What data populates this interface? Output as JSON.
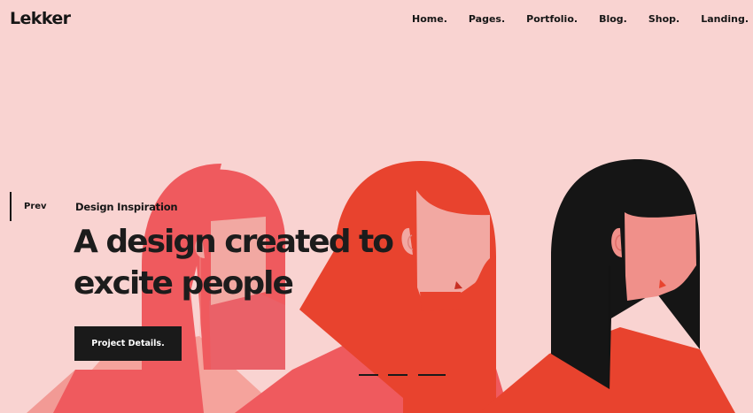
{
  "brand": {
    "logo": "Lekker"
  },
  "nav": {
    "items": [
      {
        "label": "Home."
      },
      {
        "label": "Pages."
      },
      {
        "label": "Portfolio."
      },
      {
        "label": "Blog."
      },
      {
        "label": "Shop."
      },
      {
        "label": "Landing."
      }
    ]
  },
  "slider": {
    "prev_label": "Prev",
    "eyebrow": "Design Inspiration",
    "headline_line1": "A design created to",
    "headline_line2": "excite people",
    "cta_label": "Project Details.",
    "slide_count": 3,
    "active_slide": 3
  },
  "colors": {
    "background": "#f9d3d1",
    "text": "#161616",
    "figure_pink": "#ef5a5e",
    "figure_red": "#e8432e",
    "figure_black": "#151515",
    "skin": "#f2a8a2"
  },
  "illustration": {
    "icon_names": [
      "woman-profile-pink-hair",
      "woman-profile-red-hair",
      "woman-profile-black-hair"
    ]
  }
}
